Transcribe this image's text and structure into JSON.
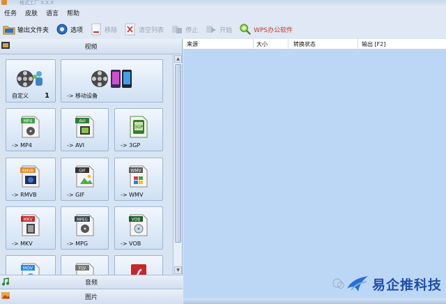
{
  "window": {
    "title": "格式工厂 X.X.X"
  },
  "menu": [
    "任务",
    "皮肤",
    "语言",
    "帮助"
  ],
  "toolbar": {
    "output_folder": "输出文件夹",
    "options": "选项",
    "remove": "移除",
    "clear_list": "清空列表",
    "stop": "停止",
    "start": "开始",
    "wps": "WPS办公软件"
  },
  "left": {
    "video_category": "视频",
    "audio_category": "音频",
    "picture_category": "图片",
    "tiles": [
      {
        "label": "自定义",
        "number": "1",
        "icon": "film-reel-users-icon"
      },
      {
        "label": "-> 移动设备",
        "icon": "film-reel-devices-icon"
      },
      {
        "label": "-> MP4",
        "icon": "mp4-file-icon",
        "badge": "MP4"
      },
      {
        "label": "-> AVI",
        "icon": "avi-file-icon",
        "badge": "AVI"
      },
      {
        "label": "-> 3GP",
        "icon": "3gp-file-icon",
        "badge": ""
      },
      {
        "label": "-> RMVB",
        "icon": "rmvb-file-icon",
        "badge": "RMVB"
      },
      {
        "label": "-> GIF",
        "icon": "gif-file-icon",
        "badge": "GIF"
      },
      {
        "label": "-> WMV",
        "icon": "wmv-file-icon",
        "badge": "WMV"
      },
      {
        "label": "-> MKV",
        "icon": "mkv-file-icon",
        "badge": "MKV"
      },
      {
        "label": "-> MPG",
        "icon": "mpg-file-icon",
        "badge": "MPEG"
      },
      {
        "label": "-> VOB",
        "icon": "vob-file-icon",
        "badge": "VOB"
      },
      {
        "label": "",
        "icon": "mov-file-icon",
        "badge": "MOV"
      },
      {
        "label": "",
        "icon": "flv-file-icon",
        "badge": "FLV"
      },
      {
        "label": "",
        "icon": "swf-file-icon",
        "badge": ""
      }
    ]
  },
  "list": {
    "columns": [
      "来源",
      "大小",
      "转换状态",
      "输出 [F2]"
    ]
  },
  "watermark": {
    "text": "易企推科技"
  },
  "colors": {
    "panel_blue": "#bcd7f6",
    "tile_border": "#9ab4d4",
    "wps_red": "#c0392b",
    "watermark_blue": "#1f4fa8"
  }
}
